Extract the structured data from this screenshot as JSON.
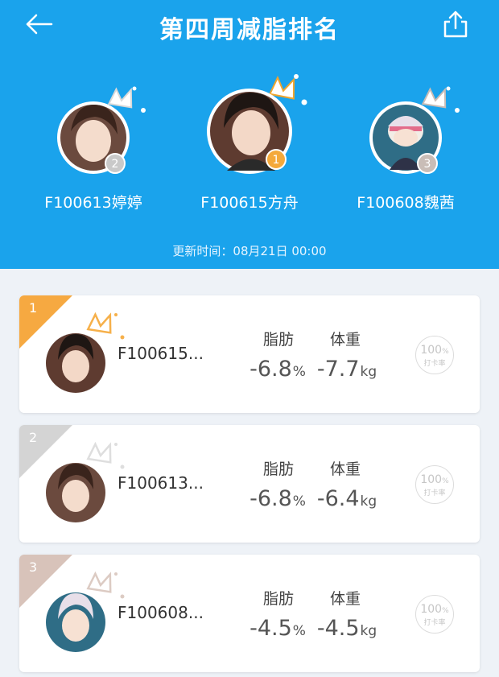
{
  "header": {
    "title": "第四周减脂排名",
    "update_text": "更新时间：08月21日 00:00"
  },
  "podium": [
    {
      "rank": "2",
      "name": "F100613婷婷",
      "badge_color": "#c9c9c9"
    },
    {
      "rank": "1",
      "name": "F100615方舟",
      "badge_color": "#f4a93b"
    },
    {
      "rank": "3",
      "name": "F100608魏茜",
      "badge_color": "#c9bdb7"
    }
  ],
  "stat_labels": {
    "fat": "脂肪",
    "weight": "体重"
  },
  "checkin": {
    "value": "100",
    "unit": "%",
    "label": "打卡率"
  },
  "list": [
    {
      "rank": "1",
      "name": "F100615...",
      "fat": "-6.8",
      "fat_unit": "%",
      "weight": "-7.7",
      "weight_unit": "kg",
      "corner_color": "#f6a941",
      "crown_color": "#f6b04a"
    },
    {
      "rank": "2",
      "name": "F100613...",
      "fat": "-6.8",
      "fat_unit": "%",
      "weight": "-6.4",
      "weight_unit": "kg",
      "corner_color": "#d4d4d4",
      "crown_color": "#dedede"
    },
    {
      "rank": "3",
      "name": "F100608...",
      "fat": "-4.5",
      "fat_unit": "%",
      "weight": "-4.5",
      "weight_unit": "kg",
      "corner_color": "#d8c3ba",
      "crown_color": "#dccbc3"
    }
  ]
}
